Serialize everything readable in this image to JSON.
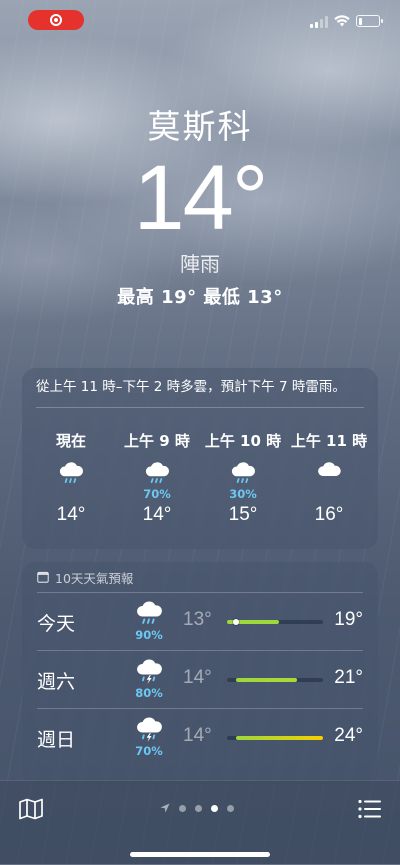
{
  "status_bar": {
    "recording_icon": "screen-recording-icon",
    "accent": "#e5322c",
    "signal_icon": "cellular-signal-icon",
    "wifi_icon": "wifi-icon",
    "battery_icon": "battery-icon",
    "battery_level": 0.15
  },
  "current": {
    "city": "莫斯科",
    "temperature": "14°",
    "condition": "陣雨",
    "hi_lo": "最高 19° 最低 13°"
  },
  "hourly": {
    "summary": "從上午 11 時–下午 2 時多雲，預計下午 7 時雷雨。",
    "hours": [
      {
        "label": "現在",
        "icon": "rain-cloud-icon",
        "precip": "",
        "temp": "14°"
      },
      {
        "label": "上午 9 時",
        "icon": "rain-cloud-icon",
        "precip": "70%",
        "temp": "14°"
      },
      {
        "label": "上午 10 時",
        "icon": "rain-cloud-icon",
        "precip": "30%",
        "temp": "15°"
      },
      {
        "label": "上午 11 時",
        "icon": "cloud-icon",
        "precip": "",
        "temp": "16°"
      }
    ]
  },
  "daily": {
    "header": "10天天氣預報",
    "header_icon": "calendar-icon",
    "range_min": 13,
    "range_max": 24,
    "days": [
      {
        "day": "今天",
        "icon": "rain-cloud-icon",
        "precip": "90%",
        "low": "13°",
        "high": "19°",
        "low_val": 13,
        "high_val": 19,
        "current_val": 14,
        "bar_colors": [
          "#9ed83a",
          "#9ed83a"
        ]
      },
      {
        "day": "週六",
        "icon": "thunderstorm-icon",
        "precip": "80%",
        "low": "14°",
        "high": "21°",
        "low_val": 14,
        "high_val": 21,
        "bar_colors": [
          "#9ed83a",
          "#a9da36"
        ]
      },
      {
        "day": "週日",
        "icon": "thunderstorm-icon",
        "precip": "70%",
        "low": "14°",
        "high": "24°",
        "low_val": 14,
        "high_val": 24,
        "bar_colors": [
          "#9ed83a",
          "#f4d000"
        ]
      }
    ]
  },
  "bottom_bar": {
    "map_icon": "map-icon",
    "list_icon": "list-icon",
    "location_icon": "location-arrow-icon",
    "pages": 3,
    "active_page": 2
  }
}
